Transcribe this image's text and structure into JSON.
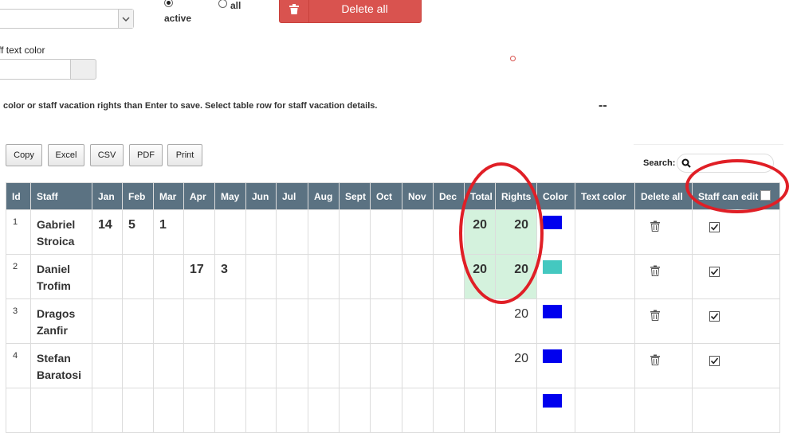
{
  "filters": {
    "radio_active_label": "active",
    "radio_all_label": "all"
  },
  "delete_all_button": {
    "label": "Delete all"
  },
  "staff_text_color_label": "ff text color",
  "info_text": "color or staff vacation rights than Enter to save. Select table row for staff vacation details.",
  "dash_text": "--",
  "export_buttons": [
    "Copy",
    "Excel",
    "CSV",
    "PDF",
    "Print"
  ],
  "search": {
    "label": "Search:"
  },
  "table": {
    "headers": {
      "id": "Id",
      "staff": "Staff",
      "jan": "Jan",
      "feb": "Feb",
      "mar": "Mar",
      "apr": "Apr",
      "may": "May",
      "jun": "Jun",
      "jul": "Jul",
      "aug": "Aug",
      "sept": "Sept",
      "oct": "Oct",
      "nov": "Nov",
      "dec": "Dec",
      "total": "Total",
      "rights": "Rights",
      "color": "Color",
      "text_color": "Text color",
      "delete_all": "Delete all",
      "staff_can_edit": "Staff can edit"
    },
    "rows": [
      {
        "id": "1",
        "first": "Gabriel",
        "last": "Stroica",
        "jan": "14",
        "feb": "5",
        "mar": "1",
        "apr": "",
        "may": "",
        "total": "20",
        "rights": "20",
        "color": "#0000ee",
        "can_edit": true
      },
      {
        "id": "2",
        "first": "Daniel",
        "last": "Trofim",
        "jan": "",
        "feb": "",
        "mar": "",
        "apr": "17",
        "may": "3",
        "total": "20",
        "rights": "20",
        "color": "#44c8c0",
        "can_edit": true
      },
      {
        "id": "3",
        "first": "Dragos",
        "last": "Zanfir",
        "jan": "",
        "feb": "",
        "mar": "",
        "apr": "",
        "may": "",
        "total": "",
        "rights": "20",
        "color": "#0000ee",
        "can_edit": true
      },
      {
        "id": "4",
        "first": "Stefan",
        "last": "Baratosi",
        "jan": "",
        "feb": "",
        "mar": "",
        "apr": "",
        "may": "",
        "total": "",
        "rights": "20",
        "color": "#0000ee",
        "can_edit": true
      }
    ]
  },
  "colors": {
    "header_bg": "#5b7282",
    "highlight": "#d4f2dd",
    "delete_red": "#d9534f",
    "annotation_red": "#e01f26"
  }
}
